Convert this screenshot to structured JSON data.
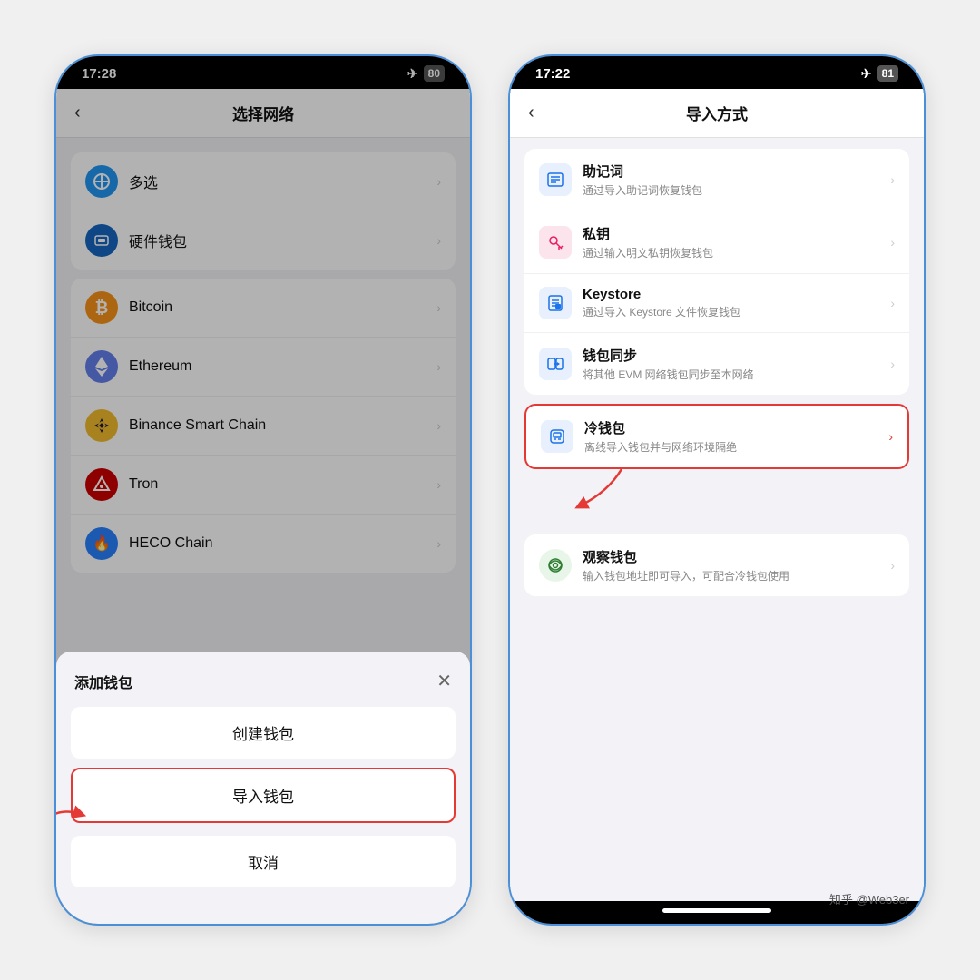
{
  "left_phone": {
    "status_time": "17:28",
    "battery": "80",
    "title": "选择网络",
    "networks": [
      {
        "name": "多选",
        "icon_class": "icon-multi",
        "icon_text": "✚"
      },
      {
        "name": "硬件钱包",
        "icon_class": "icon-hardware",
        "icon_text": "▦"
      },
      {
        "name": "Bitcoin",
        "icon_class": "icon-bitcoin",
        "icon_text": "₿"
      },
      {
        "name": "Ethereum",
        "icon_class": "icon-ethereum",
        "icon_text": "⬡"
      },
      {
        "name": "Binance Smart Chain",
        "icon_class": "icon-bnb",
        "icon_text": "⬡"
      },
      {
        "name": "Tron",
        "icon_class": "icon-tron",
        "icon_text": "◈"
      },
      {
        "name": "HECO Chain",
        "icon_class": "icon-heco",
        "icon_text": "🔥"
      }
    ],
    "modal": {
      "title": "添加钱包",
      "create_label": "创建钱包",
      "import_label": "导入钱包",
      "cancel_label": "取消"
    }
  },
  "right_phone": {
    "status_time": "17:22",
    "battery": "81",
    "title": "导入方式",
    "methods": [
      {
        "name": "助记词",
        "desc": "通过导入助记词恢复钱包",
        "icon_type": "mnemonic"
      },
      {
        "name": "私钥",
        "desc": "通过输入明文私钥恢复钱包",
        "icon_type": "key"
      },
      {
        "name": "Keystore",
        "desc": "通过导入 Keystore 文件恢复钱包",
        "icon_type": "keystore"
      },
      {
        "name": "钱包同步",
        "desc": "将其他 EVM 网络钱包同步至本网络",
        "icon_type": "sync"
      }
    ],
    "cold_wallet": {
      "name": "冷钱包",
      "desc": "离线导入钱包并与网络环境隔绝",
      "icon_type": "cold"
    },
    "watch_wallet": {
      "name": "观察钱包",
      "desc": "输入钱包地址即可导入，可配合冷钱包使用",
      "icon_type": "watch"
    }
  },
  "attribution": "知乎 @Web3er"
}
